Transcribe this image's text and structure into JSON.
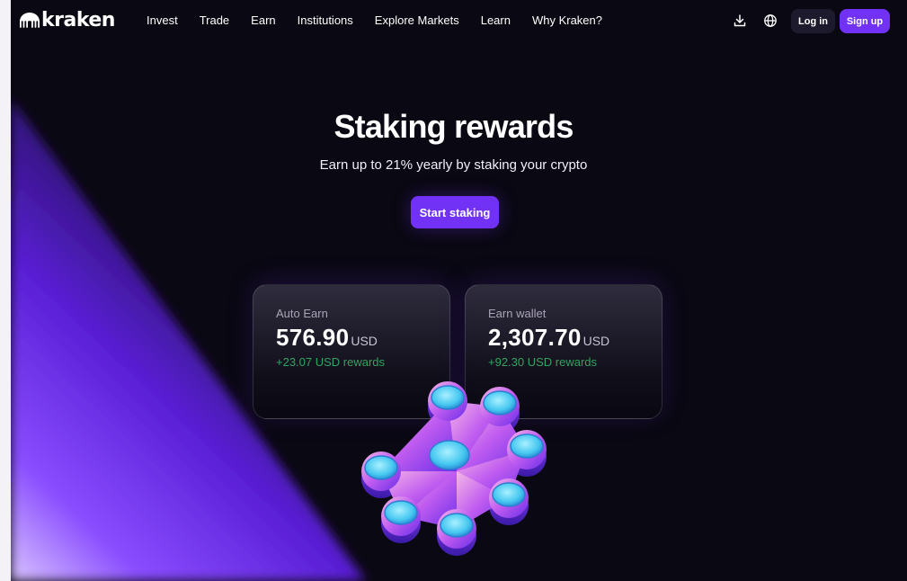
{
  "brand": {
    "name": "kraken",
    "logo_icon": "kraken-logo-icon"
  },
  "nav": {
    "links": [
      "Invest",
      "Trade",
      "Earn",
      "Institutions",
      "Explore Markets",
      "Learn",
      "Why Kraken?"
    ],
    "icons": [
      "download-icon",
      "globe-icon"
    ],
    "login_label": "Log in",
    "signup_label": "Sign up"
  },
  "hero": {
    "title": "Staking rewards",
    "subtitle": "Earn up to 21% yearly by staking your crypto",
    "cta_label": "Start staking"
  },
  "cards": [
    {
      "label": "Auto Earn",
      "amount": "576.90",
      "currency": "USD",
      "rewards": "+23.07 USD rewards"
    },
    {
      "label": "Earn wallet",
      "amount": "2,307.70",
      "currency": "USD",
      "rewards": "+92.30 USD rewards"
    }
  ],
  "colors": {
    "background": "#0a0812",
    "accent": "#7132f5",
    "reward_green": "#2fa560"
  }
}
